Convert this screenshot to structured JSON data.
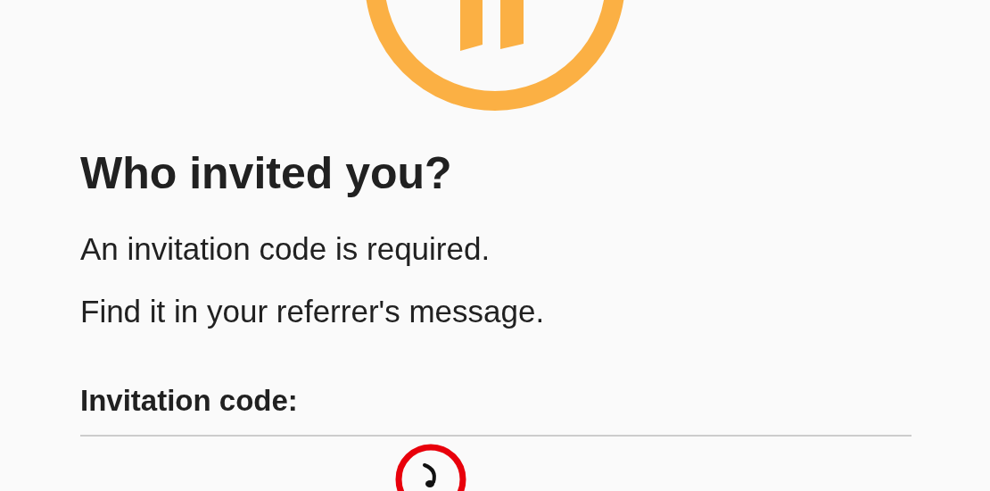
{
  "heading": "Who invited you?",
  "description": [
    "An invitation code is required.",
    "Find it in your referrer's message."
  ],
  "field": {
    "label": "Invitation code:"
  }
}
